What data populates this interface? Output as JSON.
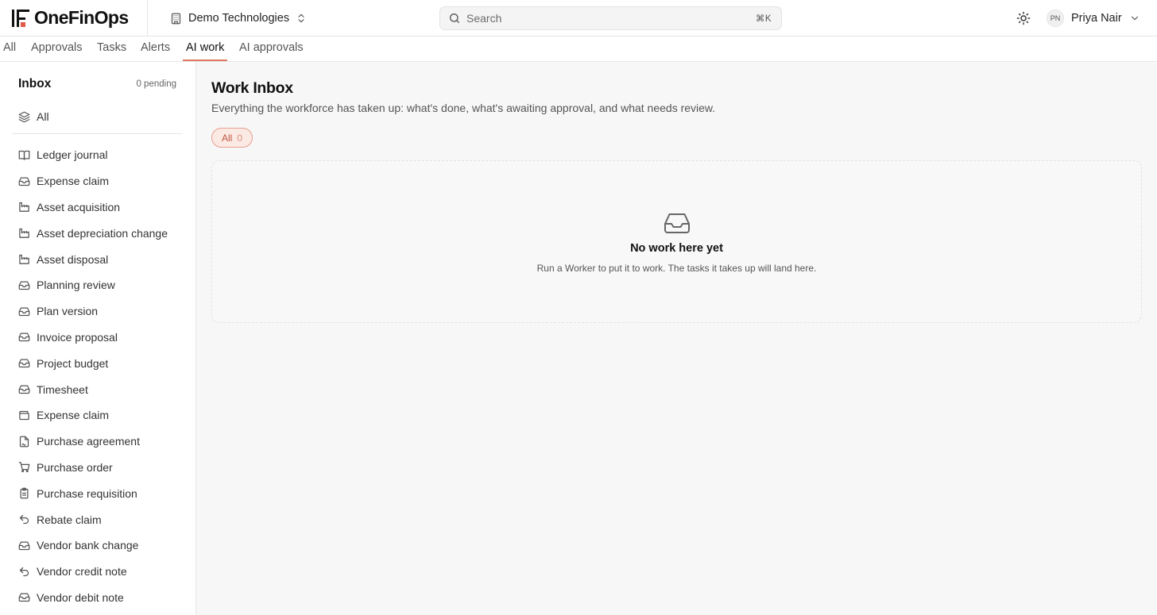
{
  "app": {
    "brand_name": "OneFinOps",
    "accent_color": "#e07a5f",
    "logo_accent_color": "#e05a47"
  },
  "header": {
    "org_name": "Demo Technologies",
    "search": {
      "placeholder": "Search",
      "shortcut": "⌘K"
    },
    "user": {
      "initials": "PN",
      "name": "Priya Nair"
    },
    "icons": [
      "building-icon",
      "chevrons-up-down-icon",
      "search-icon",
      "sun-icon",
      "chevron-down-icon"
    ]
  },
  "tabs": [
    {
      "label": "All",
      "active": false
    },
    {
      "label": "Approvals",
      "active": false
    },
    {
      "label": "Tasks",
      "active": false
    },
    {
      "label": "Alerts",
      "active": false
    },
    {
      "label": "AI work",
      "active": true
    },
    {
      "label": "AI approvals",
      "active": false
    }
  ],
  "sidebar": {
    "title": "Inbox",
    "pending": "0 pending",
    "all_label": "All",
    "items": [
      {
        "label": "Ledger journal",
        "icon": "book-icon"
      },
      {
        "label": "Expense claim",
        "icon": "inbox-icon"
      },
      {
        "label": "Asset acquisition",
        "icon": "factory-icon"
      },
      {
        "label": "Asset depreciation change",
        "icon": "factory-icon"
      },
      {
        "label": "Asset disposal",
        "icon": "factory-icon"
      },
      {
        "label": "Planning review",
        "icon": "inbox-icon"
      },
      {
        "label": "Plan version",
        "icon": "inbox-icon"
      },
      {
        "label": "Invoice proposal",
        "icon": "inbox-icon"
      },
      {
        "label": "Project budget",
        "icon": "inbox-icon"
      },
      {
        "label": "Timesheet",
        "icon": "inbox-icon"
      },
      {
        "label": "Expense claim",
        "icon": "wallet-icon"
      },
      {
        "label": "Purchase agreement",
        "icon": "file-signature-icon"
      },
      {
        "label": "Purchase order",
        "icon": "cart-icon"
      },
      {
        "label": "Purchase requisition",
        "icon": "clipboard-icon"
      },
      {
        "label": "Rebate claim",
        "icon": "undo-icon"
      },
      {
        "label": "Vendor bank change",
        "icon": "inbox-icon"
      },
      {
        "label": "Vendor credit note",
        "icon": "undo-icon"
      },
      {
        "label": "Vendor debit note",
        "icon": "inbox-icon"
      }
    ]
  },
  "main": {
    "title": "Work Inbox",
    "subtitle": "Everything the workforce has taken up: what's done, what's awaiting approval, and what needs review.",
    "filter": {
      "label": "All",
      "count": "0"
    },
    "empty_state": {
      "icon": "inbox-icon",
      "title": "No work here yet",
      "description": "Run a Worker to put it to work. The tasks it takes up will land here."
    }
  }
}
